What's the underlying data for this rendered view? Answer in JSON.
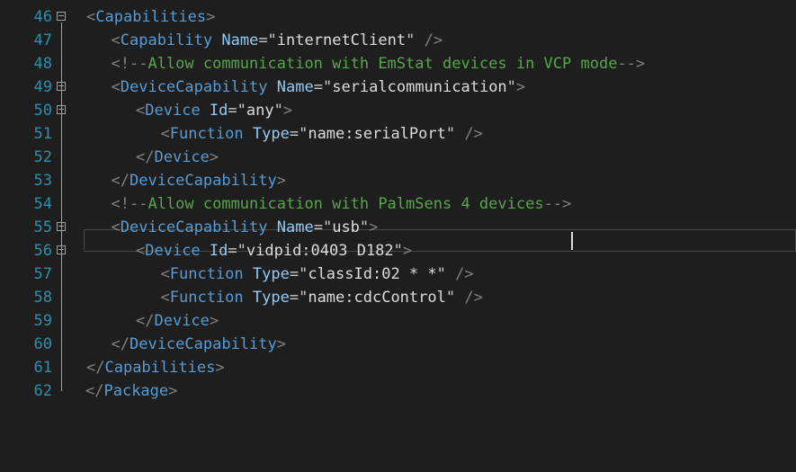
{
  "editor": {
    "lines": [
      {
        "num": "46",
        "indent": 1,
        "fold": true,
        "tokens": [
          [
            "t",
            "<"
          ],
          [
            "e",
            "Capabilities"
          ],
          [
            "t",
            ">"
          ]
        ]
      },
      {
        "num": "47",
        "indent": 2,
        "fold": false,
        "tokens": [
          [
            "t",
            "<"
          ],
          [
            "e",
            "Capability"
          ],
          [
            "v",
            " "
          ],
          [
            "a",
            "Name"
          ],
          [
            "q",
            "=\""
          ],
          [
            "v",
            "internetClient"
          ],
          [
            "q",
            "\""
          ],
          [
            "t",
            " />"
          ]
        ]
      },
      {
        "num": "48",
        "indent": 2,
        "fold": false,
        "tokens": [
          [
            "t",
            "<!--"
          ],
          [
            "c",
            "Allow communication with EmStat devices in VCP mode"
          ],
          [
            "t",
            "-->"
          ]
        ]
      },
      {
        "num": "49",
        "indent": 2,
        "fold": true,
        "tokens": [
          [
            "t",
            "<"
          ],
          [
            "e",
            "DeviceCapability"
          ],
          [
            "v",
            " "
          ],
          [
            "a",
            "Name"
          ],
          [
            "q",
            "=\""
          ],
          [
            "v",
            "serialcommunication"
          ],
          [
            "q",
            "\""
          ],
          [
            "t",
            ">"
          ]
        ]
      },
      {
        "num": "50",
        "indent": 3,
        "fold": true,
        "tokens": [
          [
            "t",
            "<"
          ],
          [
            "e",
            "Device"
          ],
          [
            "v",
            " "
          ],
          [
            "a",
            "Id"
          ],
          [
            "q",
            "=\""
          ],
          [
            "v",
            "any"
          ],
          [
            "q",
            "\""
          ],
          [
            "t",
            ">"
          ]
        ]
      },
      {
        "num": "51",
        "indent": 4,
        "fold": false,
        "tokens": [
          [
            "t",
            "<"
          ],
          [
            "e",
            "Function"
          ],
          [
            "v",
            " "
          ],
          [
            "a",
            "Type"
          ],
          [
            "q",
            "=\""
          ],
          [
            "v",
            "name:serialPort"
          ],
          [
            "q",
            "\""
          ],
          [
            "t",
            " />"
          ]
        ]
      },
      {
        "num": "52",
        "indent": 3,
        "fold": false,
        "tokens": [
          [
            "t",
            "</"
          ],
          [
            "e",
            "Device"
          ],
          [
            "t",
            ">"
          ]
        ]
      },
      {
        "num": "53",
        "indent": 2,
        "fold": false,
        "tokens": [
          [
            "t",
            "</"
          ],
          [
            "e",
            "DeviceCapability"
          ],
          [
            "t",
            ">"
          ]
        ]
      },
      {
        "num": "54",
        "indent": 2,
        "fold": false,
        "tokens": [
          [
            "t",
            "<!--"
          ],
          [
            "c",
            "Allow communication with PalmSens 4 devices"
          ],
          [
            "t",
            "-->"
          ]
        ]
      },
      {
        "num": "55",
        "indent": 2,
        "fold": true,
        "tokens": [
          [
            "t",
            "<"
          ],
          [
            "e",
            "DeviceCapability"
          ],
          [
            "v",
            " "
          ],
          [
            "a",
            "Name"
          ],
          [
            "q",
            "=\""
          ],
          [
            "v",
            "usb"
          ],
          [
            "q",
            "\""
          ],
          [
            "t",
            ">"
          ]
        ]
      },
      {
        "num": "56",
        "indent": 3,
        "fold": true,
        "tokens": [
          [
            "t",
            "<"
          ],
          [
            "e",
            "Device"
          ],
          [
            "v",
            " "
          ],
          [
            "a",
            "Id"
          ],
          [
            "q",
            "=\""
          ],
          [
            "v",
            "vidpid:0403 D182"
          ],
          [
            "q",
            "\""
          ],
          [
            "t",
            ">"
          ]
        ]
      },
      {
        "num": "57",
        "indent": 4,
        "fold": false,
        "tokens": [
          [
            "t",
            "<"
          ],
          [
            "e",
            "Function"
          ],
          [
            "v",
            " "
          ],
          [
            "a",
            "Type"
          ],
          [
            "q",
            "=\""
          ],
          [
            "v",
            "classId:02 * *"
          ],
          [
            "q",
            "\""
          ],
          [
            "t",
            " />"
          ]
        ]
      },
      {
        "num": "58",
        "indent": 4,
        "fold": false,
        "tokens": [
          [
            "t",
            "<"
          ],
          [
            "e",
            "Function"
          ],
          [
            "v",
            " "
          ],
          [
            "a",
            "Type"
          ],
          [
            "q",
            "=\""
          ],
          [
            "v",
            "name:cdcControl"
          ],
          [
            "q",
            "\""
          ],
          [
            "t",
            " />"
          ]
        ]
      },
      {
        "num": "59",
        "indent": 3,
        "fold": false,
        "tokens": [
          [
            "t",
            "</"
          ],
          [
            "e",
            "Device"
          ],
          [
            "t",
            ">"
          ]
        ]
      },
      {
        "num": "60",
        "indent": 2,
        "fold": false,
        "tokens": [
          [
            "t",
            "</"
          ],
          [
            "e",
            "DeviceCapability"
          ],
          [
            "t",
            ">"
          ]
        ]
      },
      {
        "num": "61",
        "indent": 1,
        "fold": false,
        "tokens": [
          [
            "t",
            "</"
          ],
          [
            "e",
            "Capabilities"
          ],
          [
            "t",
            ">"
          ]
        ]
      },
      {
        "num": "62",
        "indent": 0,
        "fold": false,
        "tokens": [
          [
            "t",
            "</"
          ],
          [
            "e",
            "Package"
          ],
          [
            "t",
            ">"
          ]
        ]
      }
    ],
    "current_line": "54",
    "colors": {
      "background": "#1e1e1e",
      "line_number": "#2b91af",
      "element": "#569cd6",
      "attribute": "#92caf4",
      "comment": "#57a64a",
      "bracket": "#808080",
      "value": "#dcdcdc"
    }
  }
}
